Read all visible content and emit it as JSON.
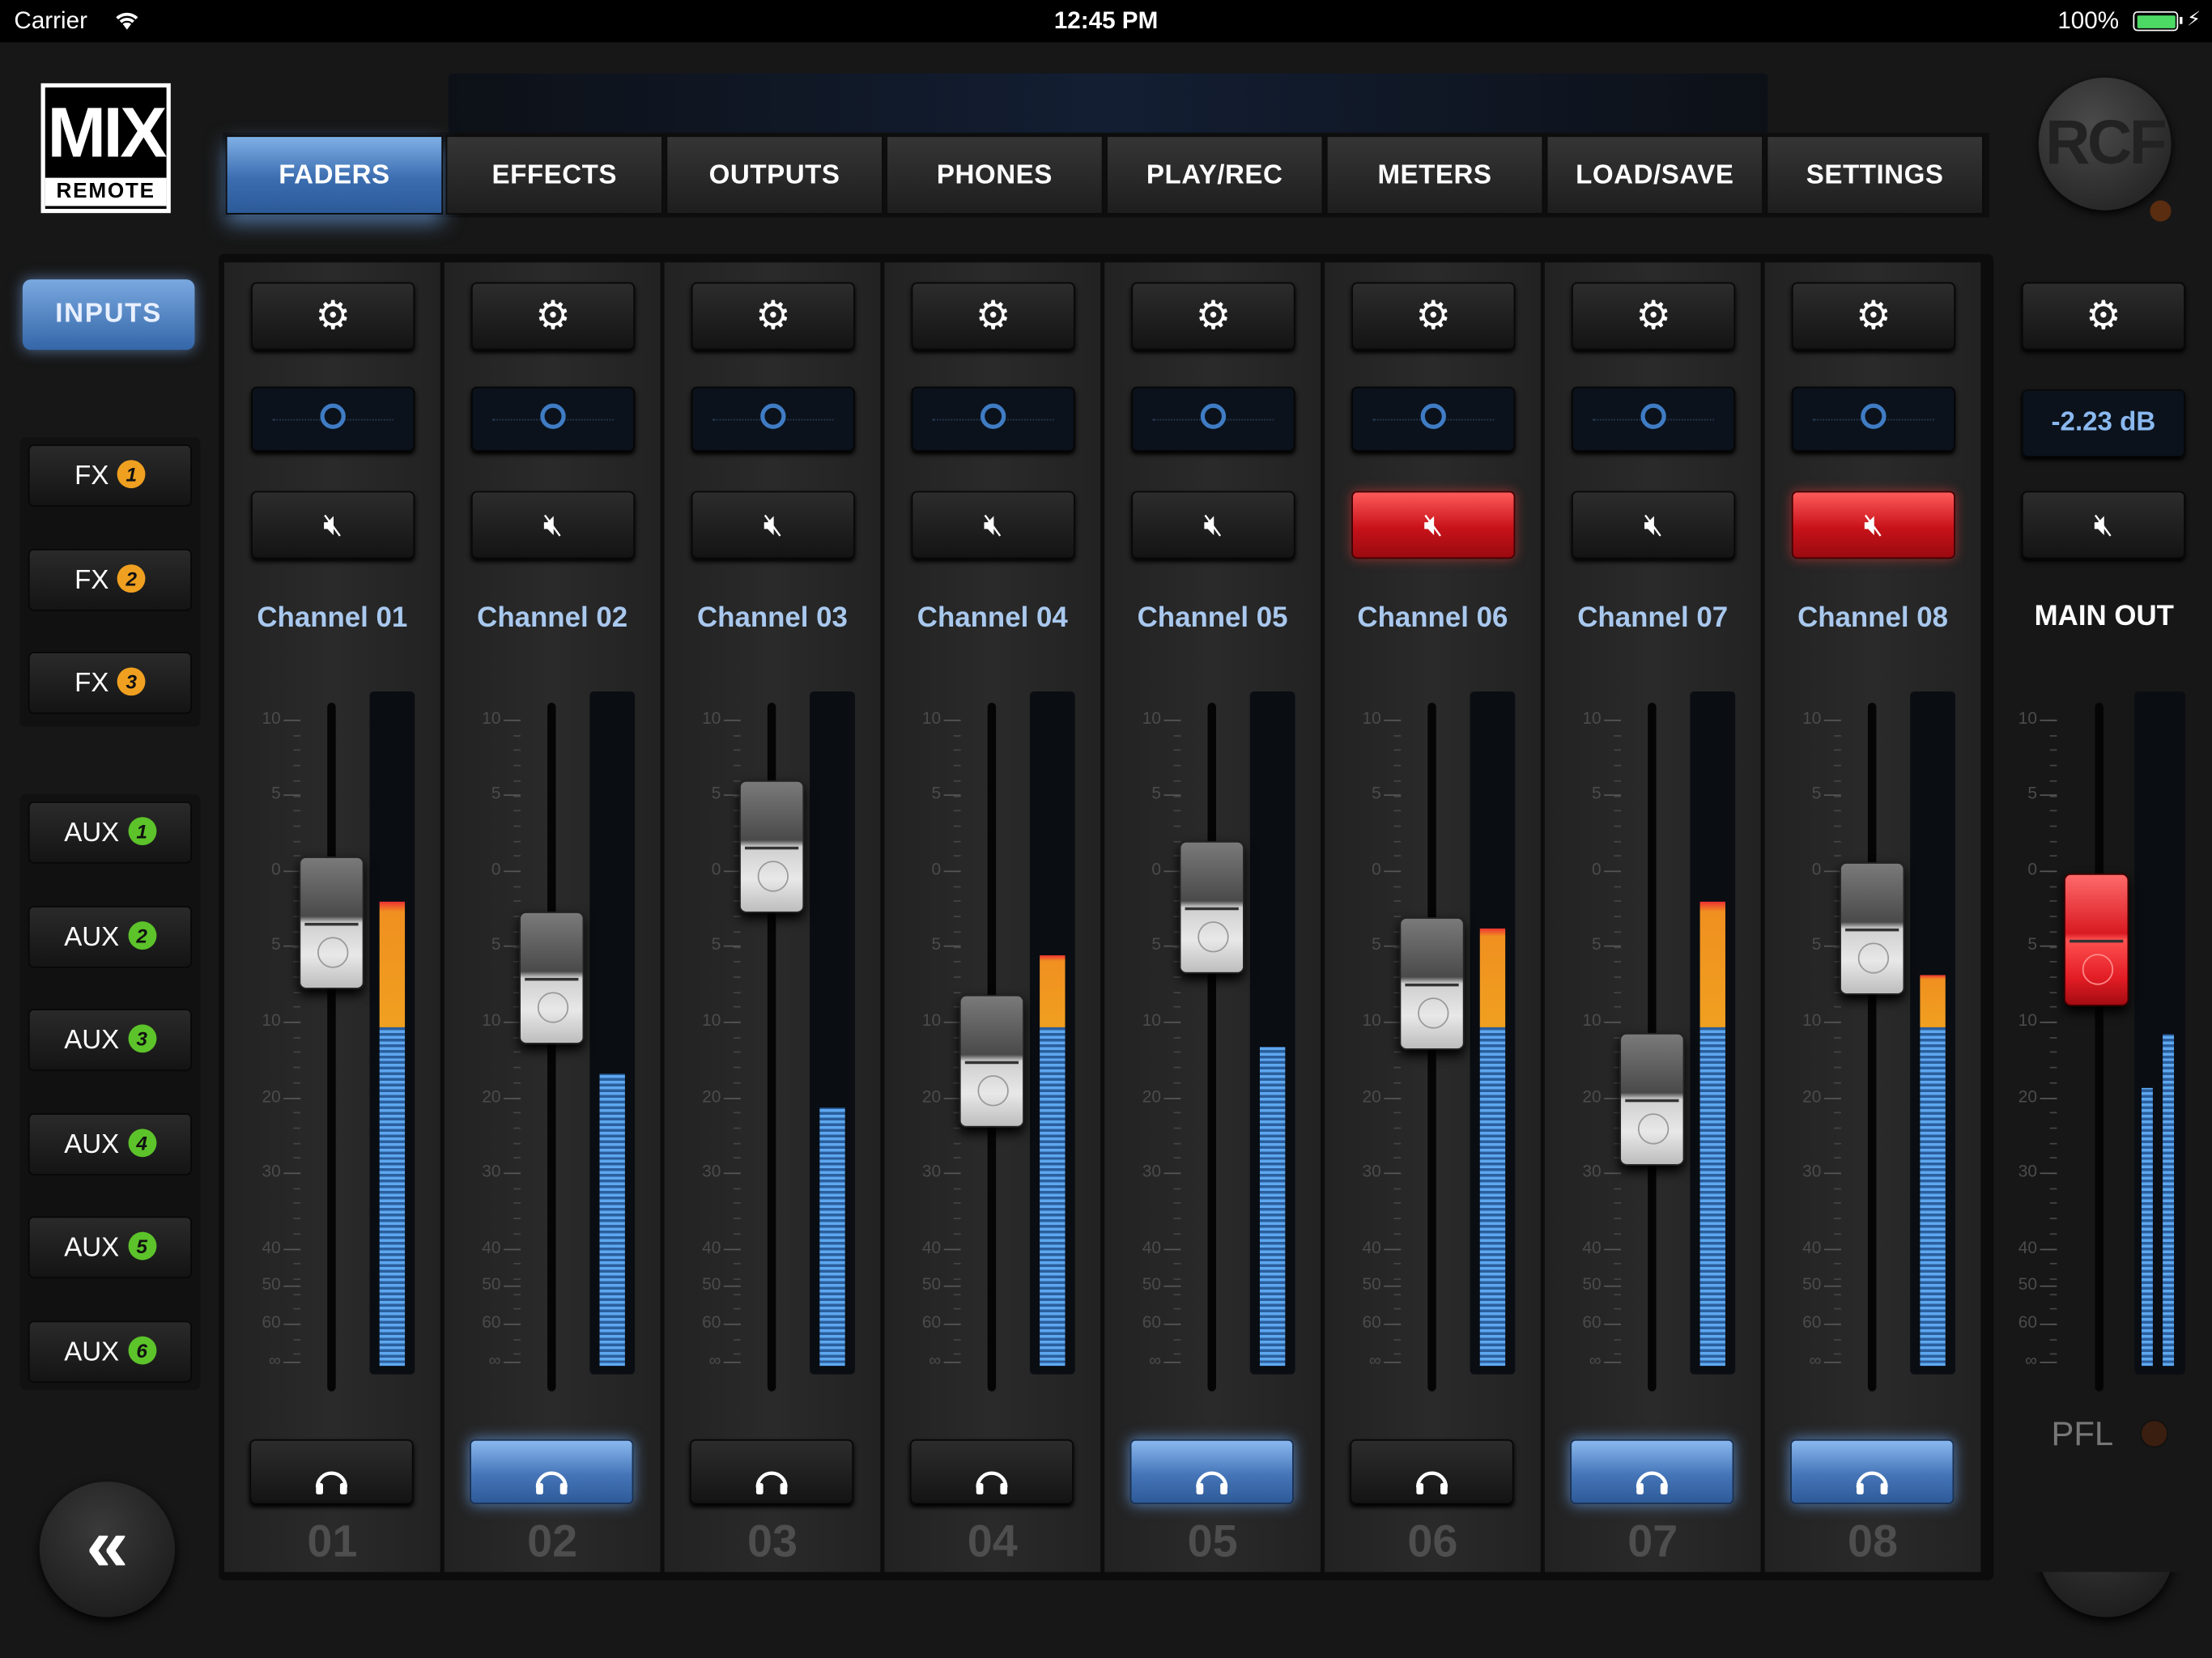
{
  "status_bar": {
    "carrier": "Carrier",
    "time": "12:45 PM",
    "battery": "100%",
    "wifi_icon": "wifi-icon",
    "battery_color": "#4cd964"
  },
  "logo": {
    "mix": "MIX",
    "remote": "REMOTE"
  },
  "brand": {
    "rcf": "RCF"
  },
  "tabs": [
    {
      "label": "FADERS",
      "active": true
    },
    {
      "label": "EFFECTS",
      "active": false
    },
    {
      "label": "OUTPUTS",
      "active": false
    },
    {
      "label": "PHONES",
      "active": false
    },
    {
      "label": "PLAY/REC",
      "active": false
    },
    {
      "label": "METERS",
      "active": false
    },
    {
      "label": "LOAD/SAVE",
      "active": false
    },
    {
      "label": "SETTINGS",
      "active": false
    }
  ],
  "sidebar": {
    "inputs": "INPUTS",
    "fx": [
      {
        "label": "FX",
        "num": "1"
      },
      {
        "label": "FX",
        "num": "2"
      },
      {
        "label": "FX",
        "num": "3"
      }
    ],
    "aux": [
      {
        "label": "AUX",
        "num": "1"
      },
      {
        "label": "AUX",
        "num": "2"
      },
      {
        "label": "AUX",
        "num": "3"
      },
      {
        "label": "AUX",
        "num": "4"
      },
      {
        "label": "AUX",
        "num": "5"
      },
      {
        "label": "AUX",
        "num": "6"
      }
    ],
    "prev": "«",
    "next": "»"
  },
  "scale_labels": [
    "10",
    "5",
    "0",
    "5",
    "10",
    "20",
    "30",
    "40",
    "50",
    "60",
    "∞"
  ],
  "channels": [
    {
      "name": "Channel 01",
      "number": "01",
      "fader": 0.72,
      "meter": 0.7,
      "peak_orange": true,
      "mute": false,
      "pfl": false
    },
    {
      "name": "Channel 02",
      "number": "02",
      "fader": 0.62,
      "meter": 0.44,
      "peak_orange": false,
      "mute": false,
      "pfl": true
    },
    {
      "name": "Channel 03",
      "number": "03",
      "fader": 0.86,
      "meter": 0.39,
      "peak_orange": false,
      "mute": false,
      "pfl": false
    },
    {
      "name": "Channel 04",
      "number": "04",
      "fader": 0.47,
      "meter": 0.62,
      "peak_orange": true,
      "mute": false,
      "pfl": false
    },
    {
      "name": "Channel 05",
      "number": "05",
      "fader": 0.75,
      "meter": 0.48,
      "peak_orange": false,
      "mute": false,
      "pfl": true
    },
    {
      "name": "Channel 06",
      "number": "06",
      "fader": 0.61,
      "meter": 0.66,
      "peak_orange": true,
      "mute": true,
      "pfl": false
    },
    {
      "name": "Channel 07",
      "number": "07",
      "fader": 0.4,
      "meter": 0.7,
      "peak_orange": true,
      "mute": false,
      "pfl": true
    },
    {
      "name": "Channel 08",
      "number": "08",
      "fader": 0.71,
      "meter": 0.59,
      "peak_orange": true,
      "mute": true,
      "pfl": true
    }
  ],
  "main_out": {
    "name": "MAIN OUT",
    "db": "-2.23 dB",
    "fader": 0.69,
    "meter_l": 0.42,
    "meter_r": 0.5,
    "pfl_label": "PFL"
  },
  "colors": {
    "accent": "#3b6db0",
    "mute_red": "#c8121a",
    "meter_blue": "#5ea8f0",
    "meter_orange": "#f0a020",
    "channel_label": "#a9c8ee"
  },
  "icons": {
    "settings": "gear-icon",
    "mute": "speaker-mute-icon",
    "pfl": "headphones-icon"
  }
}
